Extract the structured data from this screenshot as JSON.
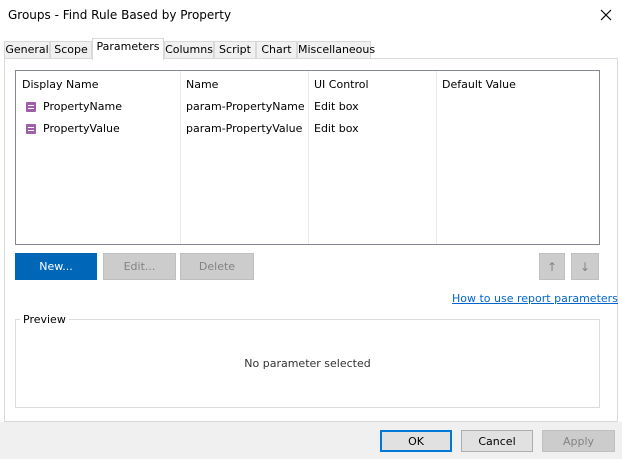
{
  "window": {
    "title": "Groups - Find Rule Based by Property"
  },
  "tabs": [
    {
      "label": "General"
    },
    {
      "label": "Scope"
    },
    {
      "label": "Parameters",
      "active": true
    },
    {
      "label": "Columns"
    },
    {
      "label": "Script"
    },
    {
      "label": "Chart"
    },
    {
      "label": "Miscellaneous"
    }
  ],
  "table": {
    "columns": [
      "Display Name",
      "Name",
      "UI Control",
      "Default Value"
    ],
    "rows": [
      {
        "display_name": "PropertyName",
        "name": "param-PropertyName",
        "ui_control": "Edit box",
        "default_value": ""
      },
      {
        "display_name": "PropertyValue",
        "name": "param-PropertyValue",
        "ui_control": "Edit box",
        "default_value": ""
      }
    ]
  },
  "actions": {
    "new": "New...",
    "edit": "Edit...",
    "delete": "Delete",
    "up": "↑",
    "down": "↓"
  },
  "help_link": "How to use report parameters",
  "preview": {
    "legend": "Preview",
    "empty_text": "No parameter selected"
  },
  "footer": {
    "ok": "OK",
    "cancel": "Cancel",
    "apply": "Apply"
  },
  "colors": {
    "accent": "#0067b8",
    "param_icon": "#9e5fa8",
    "link": "#0066cc"
  }
}
